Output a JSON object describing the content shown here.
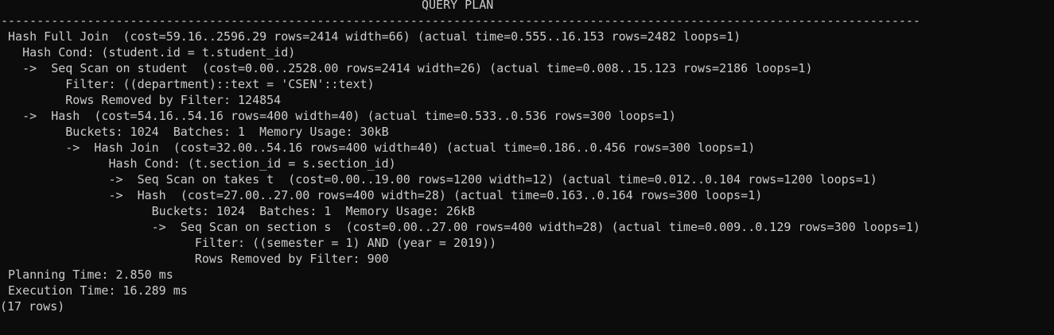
{
  "terminal": {
    "header": "QUERY PLAN",
    "separator": "--------------------------------------------------------------------------------------------------------------------------------",
    "lines": [
      " Hash Full Join  (cost=59.16..2596.29 rows=2414 width=66) (actual time=0.555..16.153 rows=2482 loops=1)",
      "   Hash Cond: (student.id = t.student_id)",
      "   ->  Seq Scan on student  (cost=0.00..2528.00 rows=2414 width=26) (actual time=0.008..15.123 rows=2186 loops=1)",
      "         Filter: ((department)::text = 'CSEN'::text)",
      "         Rows Removed by Filter: 124854",
      "   ->  Hash  (cost=54.16..54.16 rows=400 width=40) (actual time=0.533..0.536 rows=300 loops=1)",
      "         Buckets: 1024  Batches: 1  Memory Usage: 30kB",
      "         ->  Hash Join  (cost=32.00..54.16 rows=400 width=40) (actual time=0.186..0.456 rows=300 loops=1)",
      "               Hash Cond: (t.section_id = s.section_id)",
      "               ->  Seq Scan on takes t  (cost=0.00..19.00 rows=1200 width=12) (actual time=0.012..0.104 rows=1200 loops=1)",
      "               ->  Hash  (cost=27.00..27.00 rows=400 width=28) (actual time=0.163..0.164 rows=300 loops=1)",
      "                     Buckets: 1024  Batches: 1  Memory Usage: 26kB",
      "                     ->  Seq Scan on section s  (cost=0.00..27.00 rows=400 width=28) (actual time=0.009..0.129 rows=300 loops=1)",
      "                           Filter: ((semester = 1) AND (year = 2019))",
      "                           Rows Removed by Filter: 900",
      " Planning Time: 2.850 ms",
      " Execution Time: 16.289 ms"
    ],
    "footer": "(17 rows)"
  }
}
